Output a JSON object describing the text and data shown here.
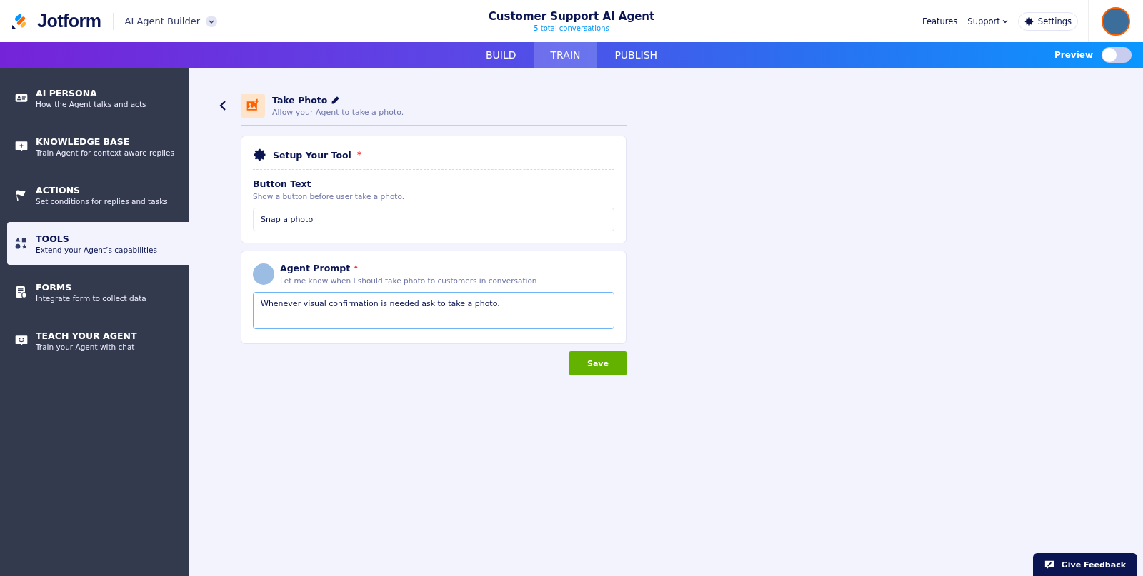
{
  "header": {
    "brand": "Jotform",
    "product": "AI Agent Builder",
    "title": "Customer Support AI Agent",
    "subtitle": "5 total conversations",
    "links": [
      "Features",
      "Support"
    ],
    "settings": "Settings"
  },
  "tabs": [
    {
      "label": "BUILD",
      "selected": false
    },
    {
      "label": "TRAIN",
      "selected": true
    },
    {
      "label": "PUBLISH",
      "selected": false
    }
  ],
  "preview": {
    "label": "Preview",
    "on": false
  },
  "sidebar": {
    "items": [
      {
        "title": "AI PERSONA",
        "subtitle": "How the Agent talks and acts",
        "selected": false
      },
      {
        "title": "KNOWLEDGE BASE",
        "subtitle": "Train Agent for context aware replies",
        "selected": false
      },
      {
        "title": "ACTIONS",
        "subtitle": "Set conditions for replies and tasks",
        "selected": false
      },
      {
        "title": "TOOLS",
        "subtitle": "Extend your Agent’s capabilities",
        "selected": true
      },
      {
        "title": "FORMS",
        "subtitle": "Integrate form to collect data",
        "selected": false
      },
      {
        "title": "TEACH YOUR AGENT",
        "subtitle": "Train your Agent with chat",
        "selected": false
      }
    ]
  },
  "tool": {
    "title": "Take Photo",
    "description": "Allow your Agent to take a photo."
  },
  "setup": {
    "title": "Setup Your Tool",
    "required_mark": "*",
    "field_label": "Button Text",
    "field_hint": "Show a button before user take a photo.",
    "value": "Snap a photo"
  },
  "prompt": {
    "title": "Agent Prompt",
    "required_mark": "*",
    "hint": "Let me know when I should take photo to customers in conversation",
    "value": "Whenever visual confirmation is needed ask to take a photo.",
    "focused": true
  },
  "save": "Save",
  "feedback": "Give Feedback"
}
